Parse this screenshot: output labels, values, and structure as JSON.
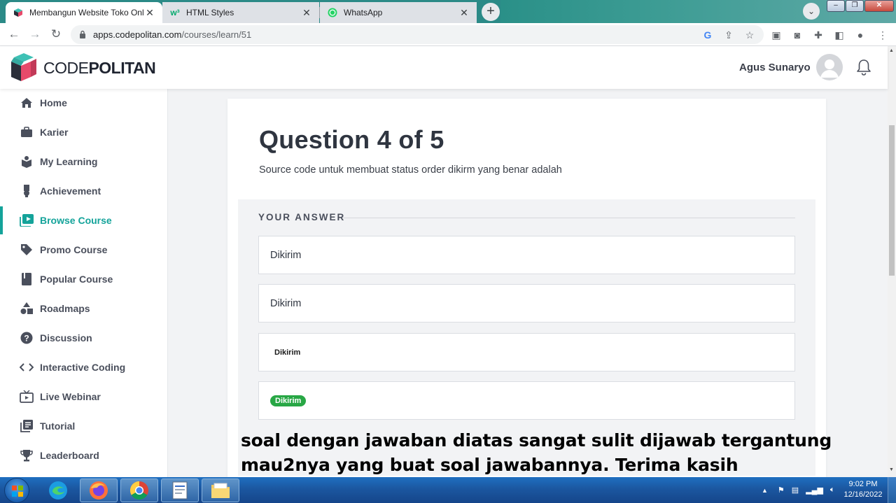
{
  "browser": {
    "tabs": [
      {
        "title": "Membangun Website Toko Onlin",
        "icon": "codepolitan-favicon",
        "active": true
      },
      {
        "title": "HTML Styles",
        "icon": "w3schools-favicon",
        "active": false
      },
      {
        "title": "WhatsApp",
        "icon": "whatsapp-favicon",
        "active": false
      }
    ],
    "url_host": "apps.codepolitan.com",
    "url_path": "/courses/learn/51"
  },
  "header": {
    "logo_text_a": "CODE",
    "logo_text_b": "POLITAN",
    "user_name": "Agus Sunaryo"
  },
  "sidebar": {
    "items": [
      {
        "label": "Home",
        "icon": "home-icon"
      },
      {
        "label": "Karier",
        "icon": "briefcase-icon"
      },
      {
        "label": "My Learning",
        "icon": "learning-box-icon"
      },
      {
        "label": "Achievement",
        "icon": "medal-icon"
      },
      {
        "label": "Browse Course",
        "icon": "play-library-icon",
        "active": true
      },
      {
        "label": "Promo Course",
        "icon": "tag-icon"
      },
      {
        "label": "Popular Course",
        "icon": "book-icon"
      },
      {
        "label": "Roadmaps",
        "icon": "shapes-icon"
      },
      {
        "label": "Discussion",
        "icon": "question-circle-icon"
      },
      {
        "label": "Interactive Coding",
        "icon": "code-icon"
      },
      {
        "label": "Live Webinar",
        "icon": "tv-play-icon"
      },
      {
        "label": "Tutorial",
        "icon": "document-list-icon"
      },
      {
        "label": "Leaderboard",
        "icon": "trophy-icon"
      }
    ]
  },
  "quiz": {
    "title": "Question 4 of 5",
    "question": "Source code untuk membuat status order dikirm yang benar adalah",
    "answer_heading": "YOUR ANSWER",
    "options": [
      {
        "text": "Dikirim"
      },
      {
        "text": "Dikirim"
      },
      {
        "text": "Dikirim"
      },
      {
        "text": "Dikirim"
      }
    ]
  },
  "overlay": {
    "line1": "soal dengan jawaban diatas sangat sulit dijawab tergantung",
    "line2": "mau2nya yang buat soal jawabannya. Terima kasih"
  },
  "taskbar": {
    "time": "9:02 PM",
    "date": "12/16/2022"
  },
  "colors": {
    "accent": "#14a39a",
    "badge_green": "#28a745",
    "tabstrip": "#2b8a87"
  }
}
